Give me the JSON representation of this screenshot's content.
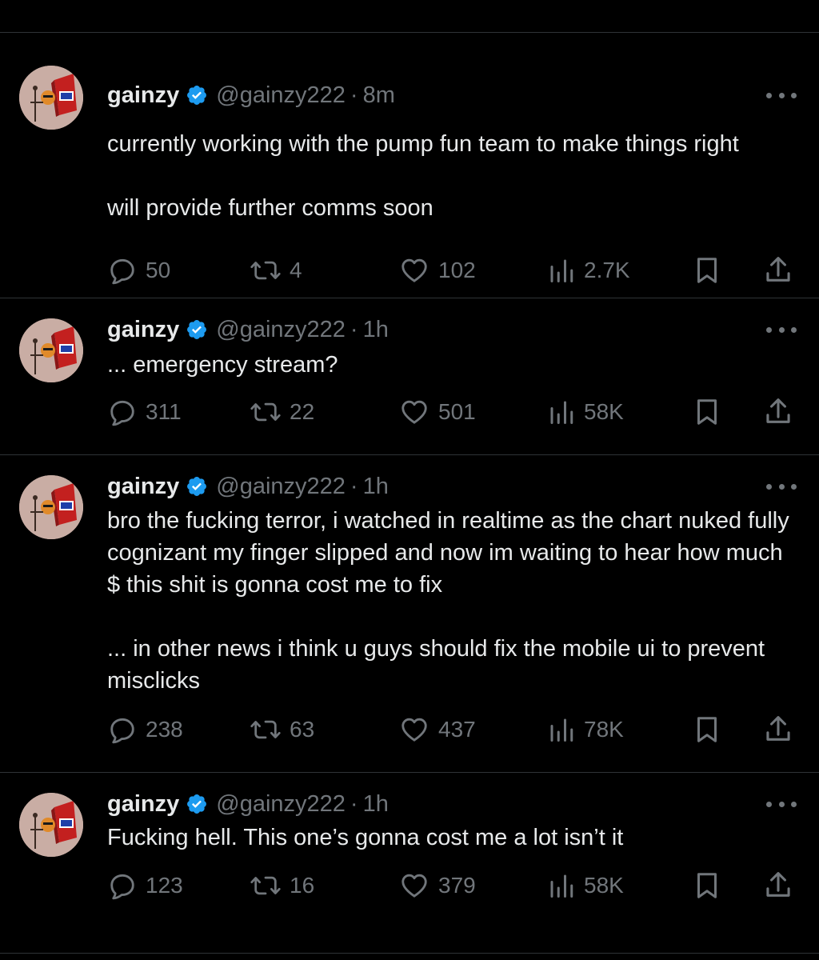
{
  "colors": {
    "background": "#000000",
    "text": "#e7e9ea",
    "muted": "#71767b",
    "verified": "#1d9bf0",
    "divider": "#2f3336"
  },
  "icons": {
    "reply": "speech-bubble-icon",
    "retweet": "retweet-arrows-icon",
    "like": "heart-icon",
    "views": "bar-chart-icon",
    "bookmark": "bookmark-icon",
    "share": "upload-arrow-icon",
    "more": "three-dots-icon",
    "verified": "verified-badge-icon"
  },
  "tweets": [
    {
      "name": "gainzy",
      "handle": "@gainzy222",
      "separator": "·",
      "time": "8m",
      "paragraphs": [
        "currently working with the pump fun team to make things right",
        "will provide further comms soon"
      ],
      "replies": "50",
      "retweets": "4",
      "likes": "102",
      "views": "2.7K"
    },
    {
      "name": "gainzy",
      "handle": "@gainzy222",
      "separator": "·",
      "time": "1h",
      "paragraphs": [
        "... emergency stream?"
      ],
      "replies": "311",
      "retweets": "22",
      "likes": "501",
      "views": "58K"
    },
    {
      "name": "gainzy",
      "handle": "@gainzy222",
      "separator": "·",
      "time": "1h",
      "paragraphs": [
        "bro the fucking terror, i watched in realtime as the chart nuked fully cognizant my finger slipped and now im waiting to hear how much $ this shit is gonna cost me to fix",
        "... in other news i think u guys should fix the mobile ui to prevent misclicks"
      ],
      "replies": "238",
      "retweets": "63",
      "likes": "437",
      "views": "78K"
    },
    {
      "name": "gainzy",
      "handle": "@gainzy222",
      "separator": "·",
      "time": "1h",
      "paragraphs": [
        "Fucking hell. This one’s gonna cost me a lot isn’t it"
      ],
      "replies": "123",
      "retweets": "16",
      "likes": "379",
      "views": "58K"
    }
  ]
}
